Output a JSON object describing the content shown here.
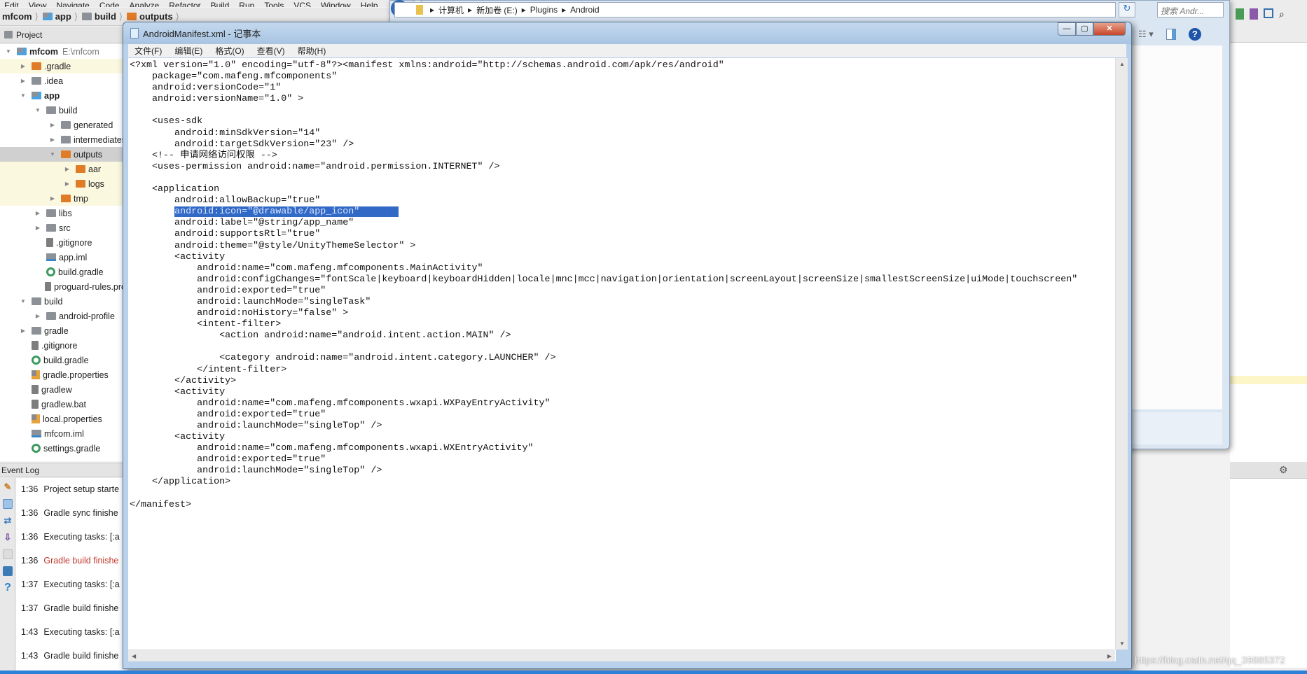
{
  "ide": {
    "menu": [
      "Edit",
      "View",
      "Navigate",
      "Code",
      "Analyze",
      "Refactor",
      "Build",
      "Run",
      "Tools",
      "VCS",
      "Window",
      "Help"
    ],
    "breadcrumb": [
      {
        "label": "mfcom",
        "icon": "none"
      },
      {
        "label": "app",
        "icon": "module-folder-icon"
      },
      {
        "label": "build",
        "icon": "folder-icon"
      },
      {
        "label": "outputs",
        "icon": "orange-folder-icon"
      }
    ],
    "project_panel_title": "Project",
    "tree": [
      {
        "level": 0,
        "arrow": "open",
        "icon": "module",
        "label": "mfcom",
        "extra": "E:\\mfcom",
        "bold": true
      },
      {
        "level": 1,
        "arrow": "closed",
        "icon": "orange",
        "label": ".gradle",
        "state": "excluded"
      },
      {
        "level": 1,
        "arrow": "closed",
        "icon": "folder",
        "label": ".idea"
      },
      {
        "level": 1,
        "arrow": "open",
        "icon": "module",
        "label": "app",
        "bold": true
      },
      {
        "level": 2,
        "arrow": "open",
        "icon": "folder",
        "label": "build"
      },
      {
        "level": 3,
        "arrow": "closed",
        "icon": "folder",
        "label": "generated"
      },
      {
        "level": 3,
        "arrow": "closed",
        "icon": "folder",
        "label": "intermediates"
      },
      {
        "level": 3,
        "arrow": "open",
        "icon": "orange",
        "label": "outputs",
        "state": "selected"
      },
      {
        "level": 4,
        "arrow": "closed",
        "icon": "orange",
        "label": "aar",
        "state": "excluded"
      },
      {
        "level": 4,
        "arrow": "closed",
        "icon": "orange",
        "label": "logs",
        "state": "excluded"
      },
      {
        "level": 3,
        "arrow": "closed",
        "icon": "orange",
        "label": "tmp",
        "state": "excluded"
      },
      {
        "level": 2,
        "arrow": "closed",
        "icon": "folder",
        "label": "libs"
      },
      {
        "level": 2,
        "arrow": "closed",
        "icon": "folder",
        "label": "src"
      },
      {
        "level": 2,
        "arrow": "none",
        "icon": "file",
        "label": ".gitignore"
      },
      {
        "level": 2,
        "arrow": "none",
        "icon": "iml",
        "label": "app.iml"
      },
      {
        "level": 2,
        "arrow": "none",
        "icon": "gradle",
        "label": "build.gradle"
      },
      {
        "level": 2,
        "arrow": "none",
        "icon": "file",
        "label": "proguard-rules.pro"
      },
      {
        "level": 1,
        "arrow": "open",
        "icon": "folder",
        "label": "build"
      },
      {
        "level": 2,
        "arrow": "closed",
        "icon": "folder",
        "label": "android-profile"
      },
      {
        "level": 1,
        "arrow": "closed",
        "icon": "folder",
        "label": "gradle"
      },
      {
        "level": 1,
        "arrow": "none",
        "icon": "file",
        "label": ".gitignore"
      },
      {
        "level": 1,
        "arrow": "none",
        "icon": "gradle",
        "label": "build.gradle"
      },
      {
        "level": 1,
        "arrow": "none",
        "icon": "props",
        "label": "gradle.properties"
      },
      {
        "level": 1,
        "arrow": "none",
        "icon": "file",
        "label": "gradlew"
      },
      {
        "level": 1,
        "arrow": "none",
        "icon": "file",
        "label": "gradlew.bat"
      },
      {
        "level": 1,
        "arrow": "none",
        "icon": "props",
        "label": "local.properties"
      },
      {
        "level": 1,
        "arrow": "none",
        "icon": "iml",
        "label": "mfcom.iml"
      },
      {
        "level": 1,
        "arrow": "none",
        "icon": "gradle",
        "label": "settings.gradle"
      }
    ],
    "event_log": {
      "title": "Event Log",
      "entries": [
        {
          "time": "1:36",
          "text": "Project setup starte",
          "error": false
        },
        {
          "time": "1:36",
          "text": "Gradle sync finishe",
          "error": false
        },
        {
          "time": "1:36",
          "text": "Executing tasks: [:a",
          "error": false
        },
        {
          "time": "1:36",
          "text": "Gradle build finishe",
          "error": true
        },
        {
          "time": "1:37",
          "text": "Executing tasks: [:a",
          "error": false
        },
        {
          "time": "1:37",
          "text": "Gradle build finishe",
          "error": false
        },
        {
          "time": "1:43",
          "text": "Executing tasks: [:a",
          "error": false
        },
        {
          "time": "1:43",
          "text": "Gradle build finishe",
          "error": false
        }
      ]
    }
  },
  "explorer": {
    "path": [
      "计算机",
      "新加卷 (E:)",
      "Plugins",
      "Android"
    ],
    "search_placeholder": "搜索 Andr..."
  },
  "notepad": {
    "title": "AndroidManifest.xml - 记事本",
    "menu": [
      "文件(F)",
      "编辑(E)",
      "格式(O)",
      "查看(V)",
      "帮助(H)"
    ],
    "selected_line": 13,
    "lines": [
      "<?xml version=\"1.0\" encoding=\"utf-8\"?><manifest xmlns:android=\"http://schemas.android.com/apk/res/android\"",
      "    package=\"com.mafeng.mfcomponents\"",
      "    android:versionCode=\"1\"",
      "    android:versionName=\"1.0\" >",
      "",
      "    <uses-sdk",
      "        android:minSdkVersion=\"14\"",
      "        android:targetSdkVersion=\"23\" />",
      "    <!-- 申请网络访问权限 -->",
      "    <uses-permission android:name=\"android.permission.INTERNET\" />",
      "",
      "    <application",
      "        android:allowBackup=\"true\"",
      "        android:icon=\"@drawable/app_icon\"",
      "        android:label=\"@string/app_name\"",
      "        android:supportsRtl=\"true\"",
      "        android:theme=\"@style/UnityThemeSelector\" >",
      "        <activity",
      "            android:name=\"com.mafeng.mfcomponents.MainActivity\"",
      "            android:configChanges=\"fontScale|keyboard|keyboardHidden|locale|mnc|mcc|navigation|orientation|screenLayout|screenSize|smallestScreenSize|uiMode|touchscreen\"",
      "            android:exported=\"true\"",
      "            android:launchMode=\"singleTask\"",
      "            android:noHistory=\"false\" >",
      "            <intent-filter>",
      "                <action android:name=\"android.intent.action.MAIN\" />",
      "",
      "                <category android:name=\"android.intent.category.LAUNCHER\" />",
      "            </intent-filter>",
      "        </activity>",
      "        <activity",
      "            android:name=\"com.mafeng.mfcomponents.wxapi.WXPayEntryActivity\"",
      "            android:exported=\"true\"",
      "            android:launchMode=\"singleTop\" />",
      "        <activity",
      "            android:name=\"com.mafeng.mfcomponents.wxapi.WXEntryActivity\"",
      "            android:exported=\"true\"",
      "            android:launchMode=\"singleTop\" />",
      "    </application>",
      "",
      "</manifest>"
    ]
  },
  "watermark": "https://blog.csdn.net/qq_39885372",
  "colors": {
    "selection": "#3169c6",
    "error_text": "#c0392b",
    "excluded_bg": "#fbf8e0",
    "selected_row": "#d0d0d0"
  }
}
